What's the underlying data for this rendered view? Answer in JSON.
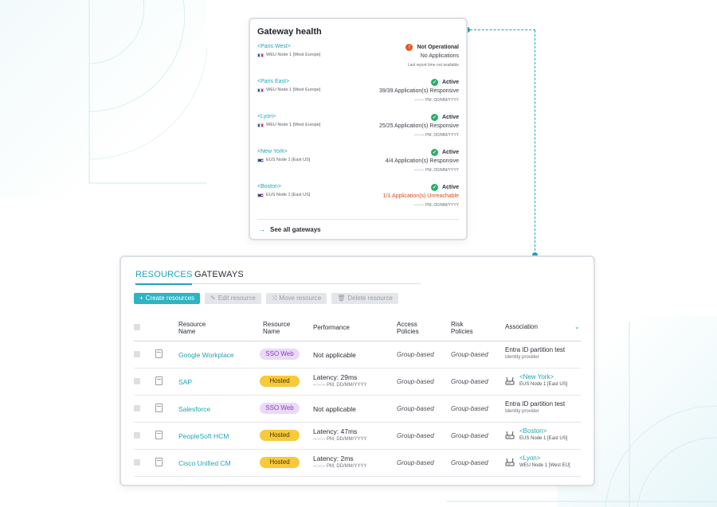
{
  "gateway_health": {
    "title": "Gateway health",
    "gateways": [
      {
        "name": "<Paris West>",
        "node": "WEU Node 1 [West Europe]",
        "flag": "fr",
        "status": "Not Operational",
        "status_kind": "error",
        "detail": "No Applications",
        "detail_kind": "normal",
        "time": "Last report time not available"
      },
      {
        "name": "<Paris East>",
        "node": "WEU Node 1 [West Europe]",
        "flag": "fr",
        "status": "Active",
        "status_kind": "ok",
        "detail": "39/39 Application(s) Responsive",
        "detail_kind": "normal",
        "time": "--:--:-- PM, DD/MM/YYYY"
      },
      {
        "name": "<Lyon>",
        "node": "WEU Node 1 [West Europe]",
        "flag": "fr",
        "status": "Active",
        "status_kind": "ok",
        "detail": "25/25 Application(s) Responsive",
        "detail_kind": "normal",
        "time": "--:--:-- PM, DD/MM/YYYY"
      },
      {
        "name": "<New York>",
        "node": "EUS Node 1 [East US]",
        "flag": "us",
        "status": "Active",
        "status_kind": "ok",
        "detail": "4/4 Application(s) Responsive",
        "detail_kind": "normal",
        "time": "--:--:-- PM, DD/MM/YYYY"
      },
      {
        "name": "<Boston>",
        "node": "EUS Node 1 [East US]",
        "flag": "us",
        "status": "Active",
        "status_kind": "ok",
        "detail": "1/1 Application(s) Unreachable",
        "detail_kind": "error",
        "time": "--:--:-- PM, DD/MM/YYYY"
      }
    ],
    "see_all": "See all gateways"
  },
  "resources": {
    "tabs": {
      "resources": "RESOURCES",
      "gateways": "GATEWAYS"
    },
    "toolbar": {
      "create": "Create resources",
      "edit": "Edit resource",
      "move": "Move resource",
      "delete": "Delete resource"
    },
    "columns": {
      "name": "Resource Name",
      "type": "Resource Name",
      "performance": "Performance",
      "access": "Access Policies",
      "risk": "Risk Policies",
      "association": "Association"
    },
    "rows": [
      {
        "name": "Google Workplace",
        "type": "SSO Web",
        "type_kind": "sso",
        "performance": "Not applicable",
        "perf_time": "",
        "access": "Group-based",
        "risk": "Group-based",
        "assoc_kind": "idp",
        "assoc_main": "Entra ID partition test",
        "assoc_sub": "Identity provider"
      },
      {
        "name": "SAP",
        "type": "Hosted",
        "type_kind": "hosted",
        "performance": "Latency: 29ms",
        "perf_time": "--:--:-- PM, DD/MM/YYYY",
        "access": "Group-based",
        "risk": "Group-based",
        "assoc_kind": "gateway",
        "assoc_main": "<New York>",
        "assoc_sub": "EUS Node 1 [East US]"
      },
      {
        "name": "Salesforce",
        "type": "SSO Web",
        "type_kind": "sso",
        "performance": "Not applicable",
        "perf_time": "",
        "access": "Group-based",
        "risk": "Group-based",
        "assoc_kind": "idp",
        "assoc_main": "Entra ID partition test",
        "assoc_sub": "Identity provider"
      },
      {
        "name": "PeopleSoft HCM",
        "type": "Hosted",
        "type_kind": "hosted",
        "performance": "Latency: 47ms",
        "perf_time": "--:--:-- PM, DD/MM/YYYY",
        "access": "Group-based",
        "risk": "Group-based",
        "assoc_kind": "gateway",
        "assoc_main": "<Boston>",
        "assoc_sub": "EUS Node 1 [East US]"
      },
      {
        "name": "Cisco Unified CM",
        "type": "Hosted",
        "type_kind": "hosted",
        "performance": "Latency: 2ms",
        "perf_time": "--:--:-- PM, DD/MM/YYYY",
        "access": "Group-based",
        "risk": "Group-based",
        "assoc_kind": "gateway",
        "assoc_main": "<Lyon>",
        "assoc_sub": "WEU Node 1 [West EU]"
      }
    ]
  },
  "colors": {
    "accent": "#21a4b8",
    "ok": "#2cad6b",
    "error": "#e4561f",
    "sso": "#ead9f7",
    "hosted": "#f7c93b"
  }
}
